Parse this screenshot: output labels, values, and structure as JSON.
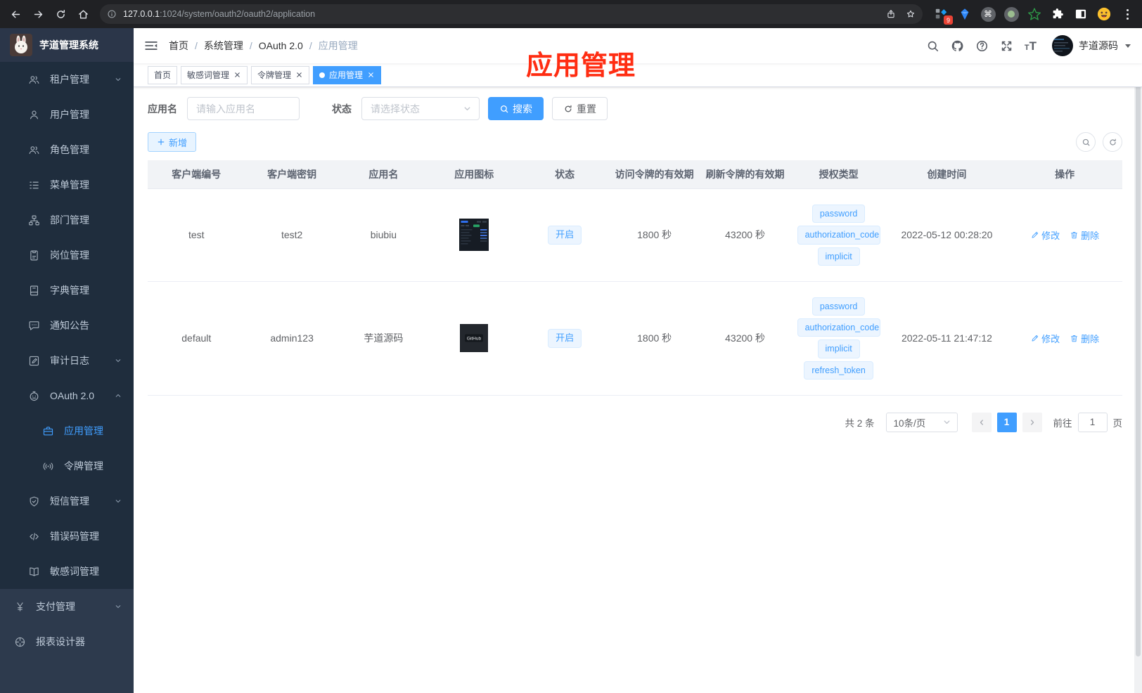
{
  "browser": {
    "url": {
      "host": "127.0.0.1",
      "rest": ":1024/system/oauth2/oauth2/application"
    },
    "extensions_badge": "9"
  },
  "app_title": "芋道管理系统",
  "sidebar": {
    "items": [
      {
        "key": "tenant",
        "label": "租户管理",
        "icon": "people",
        "level": 1,
        "arrow": "down",
        "section": "sys"
      },
      {
        "key": "user",
        "label": "用户管理",
        "icon": "user",
        "level": 1,
        "section": "sys"
      },
      {
        "key": "role",
        "label": "角色管理",
        "icon": "people",
        "level": 1,
        "section": "sys"
      },
      {
        "key": "menu",
        "label": "菜单管理",
        "icon": "menu-tree",
        "level": 1,
        "section": "sys"
      },
      {
        "key": "dept",
        "label": "部门管理",
        "icon": "org",
        "level": 1,
        "section": "sys"
      },
      {
        "key": "post",
        "label": "岗位管理",
        "icon": "badge",
        "level": 1,
        "section": "sys"
      },
      {
        "key": "dict",
        "label": "字典管理",
        "icon": "book",
        "level": 1,
        "section": "sys"
      },
      {
        "key": "notice",
        "label": "通知公告",
        "icon": "comment",
        "level": 1,
        "section": "sys"
      },
      {
        "key": "audit-log",
        "label": "审计日志",
        "icon": "edit",
        "level": 1,
        "arrow": "down",
        "section": "sys"
      },
      {
        "key": "oauth2",
        "label": "OAuth 2.0",
        "icon": "robot",
        "level": 1,
        "arrow": "up",
        "section": "sys"
      },
      {
        "key": "oauth2-app",
        "label": "应用管理",
        "icon": "briefcase",
        "level": 2,
        "active": true,
        "section": "sys"
      },
      {
        "key": "oauth2-token",
        "label": "令牌管理",
        "icon": "signal",
        "level": 2,
        "section": "sys"
      },
      {
        "key": "sms",
        "label": "短信管理",
        "icon": "shield",
        "level": 1,
        "arrow": "down",
        "section": "sys"
      },
      {
        "key": "error-code",
        "label": "错误码管理",
        "icon": "code",
        "level": 1,
        "section": "sys"
      },
      {
        "key": "sensitive-word",
        "label": "敏感词管理",
        "icon": "openbook",
        "level": 1,
        "section": "sys"
      },
      {
        "key": "pay",
        "label": "支付管理",
        "icon": "yen",
        "level": 0,
        "arrow": "down",
        "section": "root"
      },
      {
        "key": "report-designer",
        "label": "报表设计器",
        "icon": "report",
        "level": 0,
        "section": "root"
      }
    ]
  },
  "navbar": {
    "breadcrumb": [
      "首页",
      "系统管理",
      "OAuth 2.0",
      "应用管理"
    ],
    "breadcrumb_separator": "/",
    "user_name": "芋道源码"
  },
  "annotation": {
    "text": "应用管理"
  },
  "tags_view": {
    "tabs": [
      {
        "key": "home",
        "label": "首页",
        "closable": false,
        "active": false
      },
      {
        "key": "sensitive-word",
        "label": "敏感词管理",
        "closable": true,
        "active": false
      },
      {
        "key": "token-manage",
        "label": "令牌管理",
        "closable": true,
        "active": false
      },
      {
        "key": "app-manage",
        "label": "应用管理",
        "closable": true,
        "active": true
      }
    ]
  },
  "filter": {
    "name_label": "应用名",
    "name_placeholder": "请输入应用名",
    "status_label": "状态",
    "status_placeholder": "请选择状态",
    "search_label": "搜索",
    "reset_label": "重置"
  },
  "toolbar": {
    "add_label": "新增"
  },
  "table": {
    "headers": [
      "客户端编号",
      "客户端密钥",
      "应用名",
      "应用图标",
      "状态",
      "访问令牌的有效期",
      "刷新令牌的有效期",
      "授权类型",
      "创建时间",
      "操作"
    ],
    "action_edit": "修改",
    "action_delete": "删除",
    "rows": [
      {
        "client_id": "test",
        "secret": "test2",
        "name": "biubiu",
        "icon": "dashboard-thumb",
        "status": "开启",
        "access_validity": "1800 秒",
        "refresh_validity": "43200 秒",
        "grant_types": [
          "password",
          "authorization_code",
          "implicit"
        ],
        "created_at": "2022-05-12 00:28:20"
      },
      {
        "client_id": "default",
        "secret": "admin123",
        "name": "芋道源码",
        "icon": "github-thumb",
        "icon_text": "GitHub",
        "status": "开启",
        "access_validity": "1800 秒",
        "refresh_validity": "43200 秒",
        "grant_types": [
          "password",
          "authorization_code",
          "implicit",
          "refresh_token"
        ],
        "created_at": "2022-05-11 21:47:12"
      }
    ]
  },
  "pagination": {
    "total_text": "共 2 条",
    "page_size": "10条/页",
    "current_page": "1",
    "goto_label": "前往",
    "goto_value": "1",
    "page_unit": "页"
  },
  "colors": {
    "primary": "#409eff",
    "sidebar_bg": "#1f2d3d",
    "sidebar_section_bg": "#2d3a4d",
    "tag_bg": "#ecf5ff",
    "annotation": "#ff2d12"
  }
}
